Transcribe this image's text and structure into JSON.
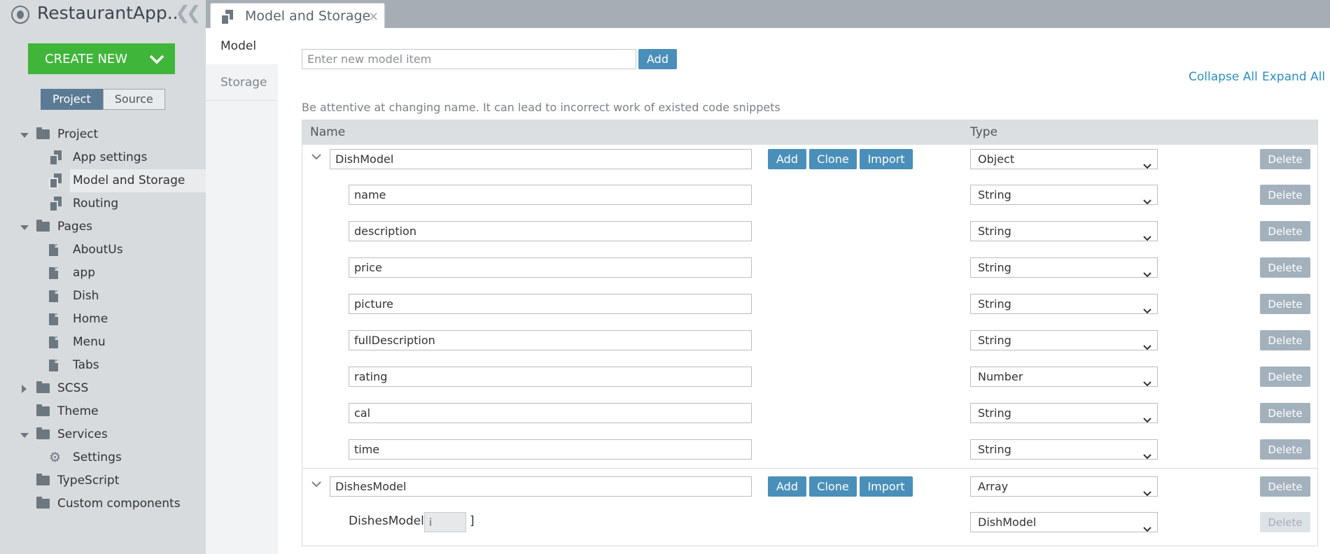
{
  "app": {
    "title": "RestaurantApp..."
  },
  "sidebar": {
    "create_new_label": "CREATE NEW",
    "toggle": {
      "project": "Project",
      "source": "Source",
      "active": "Project"
    },
    "tree": [
      {
        "label": "Project",
        "icon": "folder-icon",
        "expanded": true
      },
      {
        "label": "App settings",
        "icon": "files-icon"
      },
      {
        "label": "Model and Storage",
        "icon": "files-icon",
        "selected": true
      },
      {
        "label": "Routing",
        "icon": "files-icon"
      },
      {
        "label": "Pages",
        "icon": "folder-icon",
        "expanded": true
      },
      {
        "label": "AboutUs",
        "icon": "file-icon"
      },
      {
        "label": "app",
        "icon": "file-icon"
      },
      {
        "label": "Dish",
        "icon": "file-icon"
      },
      {
        "label": "Home",
        "icon": "file-icon"
      },
      {
        "label": "Menu",
        "icon": "file-icon"
      },
      {
        "label": "Tabs",
        "icon": "file-icon"
      },
      {
        "label": "SCSS",
        "icon": "folder-icon",
        "expanded": false
      },
      {
        "label": "Theme",
        "icon": "folder-icon"
      },
      {
        "label": "Services",
        "icon": "folder-icon",
        "expanded": true
      },
      {
        "label": "Settings",
        "icon": "gear-icon"
      },
      {
        "label": "TypeScript",
        "icon": "folder-icon"
      },
      {
        "label": "Custom components",
        "icon": "folder-icon"
      }
    ]
  },
  "tab": {
    "title": "Model and Storage",
    "close": "×"
  },
  "subnav": {
    "model": "Model",
    "storage": "Storage"
  },
  "main": {
    "new_item_placeholder": "Enter new model item",
    "add_label": "Add",
    "collapse_all": "Collapse All",
    "expand_all": "Expand All",
    "hint": "Be attentive at changing name. It can lead to incorrect work of existed code snippets",
    "columns": {
      "name": "Name",
      "type": "Type"
    },
    "buttons": {
      "add": "Add",
      "clone": "Clone",
      "import": "Import",
      "delete": "Delete"
    },
    "rows": [
      {
        "kind": "parent",
        "name": "DishModel",
        "type": "Object"
      },
      {
        "kind": "child",
        "name": "name",
        "type": "String"
      },
      {
        "kind": "child",
        "name": "description",
        "type": "String"
      },
      {
        "kind": "child",
        "name": "price",
        "type": "String"
      },
      {
        "kind": "child",
        "name": "picture",
        "type": "String"
      },
      {
        "kind": "child",
        "name": "fullDescription",
        "type": "String"
      },
      {
        "kind": "child",
        "name": "rating",
        "type": "Number"
      },
      {
        "kind": "child",
        "name": "cal",
        "type": "String"
      },
      {
        "kind": "child",
        "name": "time",
        "type": "String"
      },
      {
        "kind": "parent",
        "name": "DishesModel",
        "type": "Array"
      },
      {
        "kind": "array-item",
        "name": "DishesModel[",
        "index": "i",
        "close": "]",
        "type": "DishModel",
        "delete_disabled": true
      }
    ]
  },
  "colors": {
    "accent_green": "#3fb63a",
    "button_blue": "#4a8fb9",
    "link_blue": "#2c8fc4",
    "sidebar_bg": "#d7dbde",
    "toggle_active": "#5b7b95",
    "delete_bg": "#a3b1bd"
  }
}
